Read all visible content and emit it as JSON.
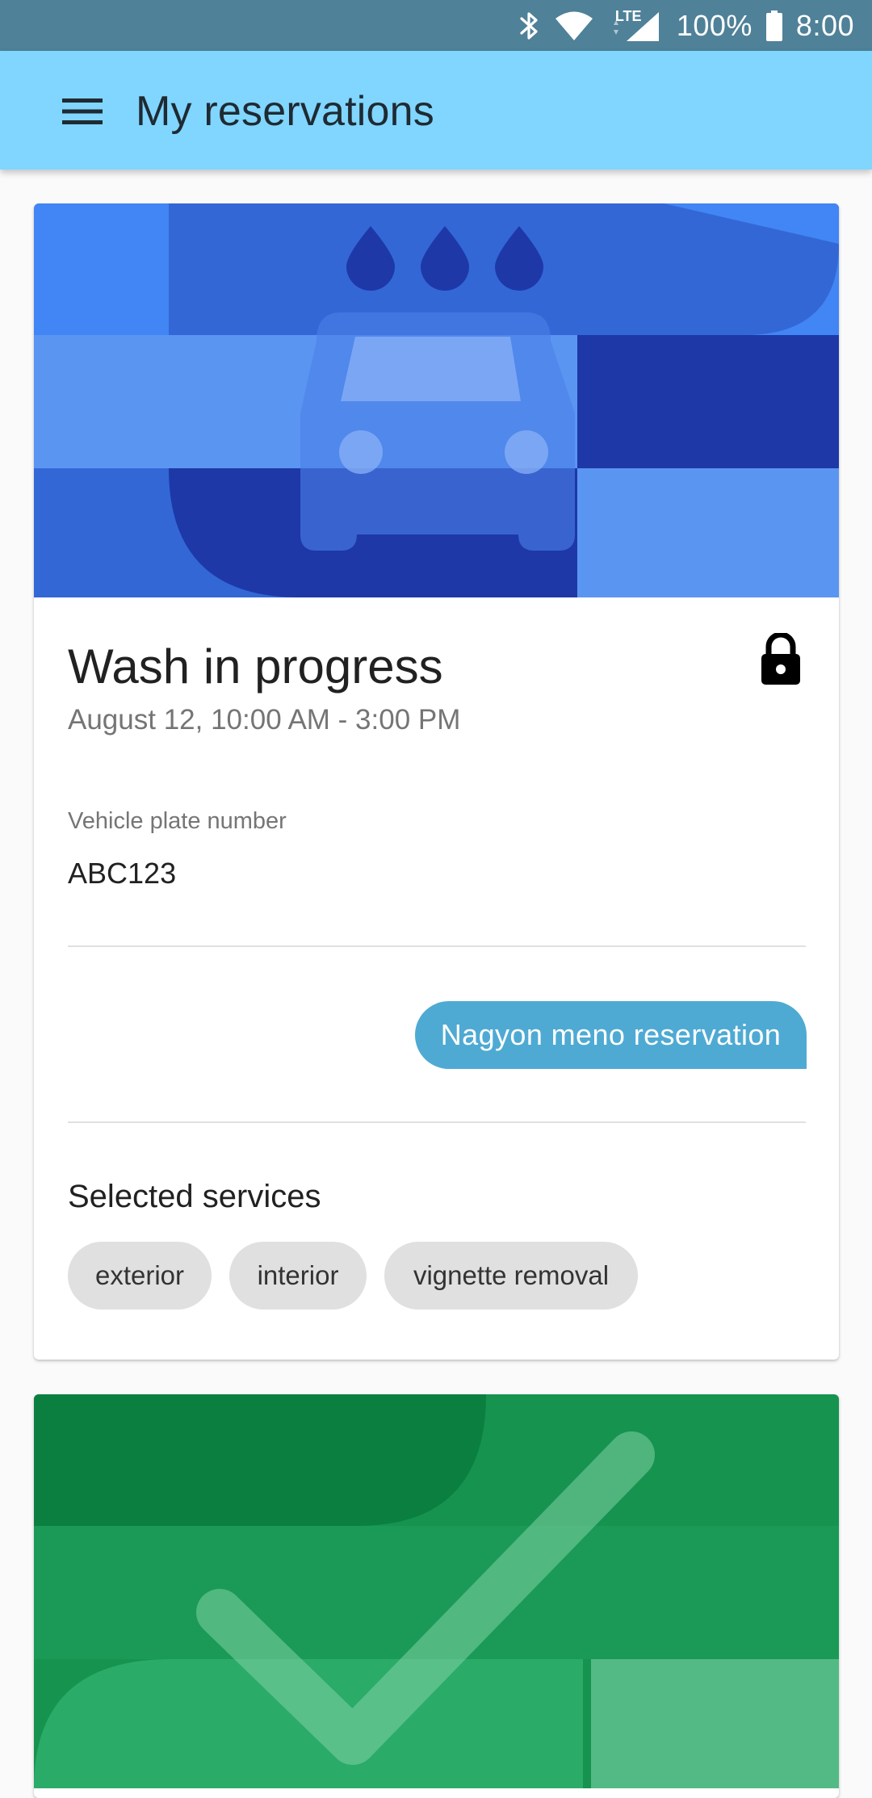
{
  "status_bar": {
    "network": "LTE",
    "battery_percent": "100%",
    "time": "8:00",
    "icons": [
      "bluetooth-icon",
      "wifi-icon",
      "signal-icon",
      "battery-icon"
    ]
  },
  "app_bar": {
    "title": "My reservations",
    "menu_icon": "menu-icon",
    "background": "#80d6ff"
  },
  "reservations": [
    {
      "hero_icon": "car-wash-icon",
      "hero_color": "#4285f4",
      "status": "Wash in progress",
      "datetime": "August 12, 10:00 AM - 3:00 PM",
      "locked_icon": "lock-icon",
      "plate_label": "Vehicle plate number",
      "plate_value": "ABC123",
      "action_label": "Nagyon meno reservation",
      "action_color": "#4eaad3",
      "services_title": "Selected services",
      "services": [
        "exterior",
        "interior",
        "vignette removal"
      ]
    },
    {
      "hero_icon": "checkmark-icon",
      "hero_color": "#16934f"
    }
  ]
}
